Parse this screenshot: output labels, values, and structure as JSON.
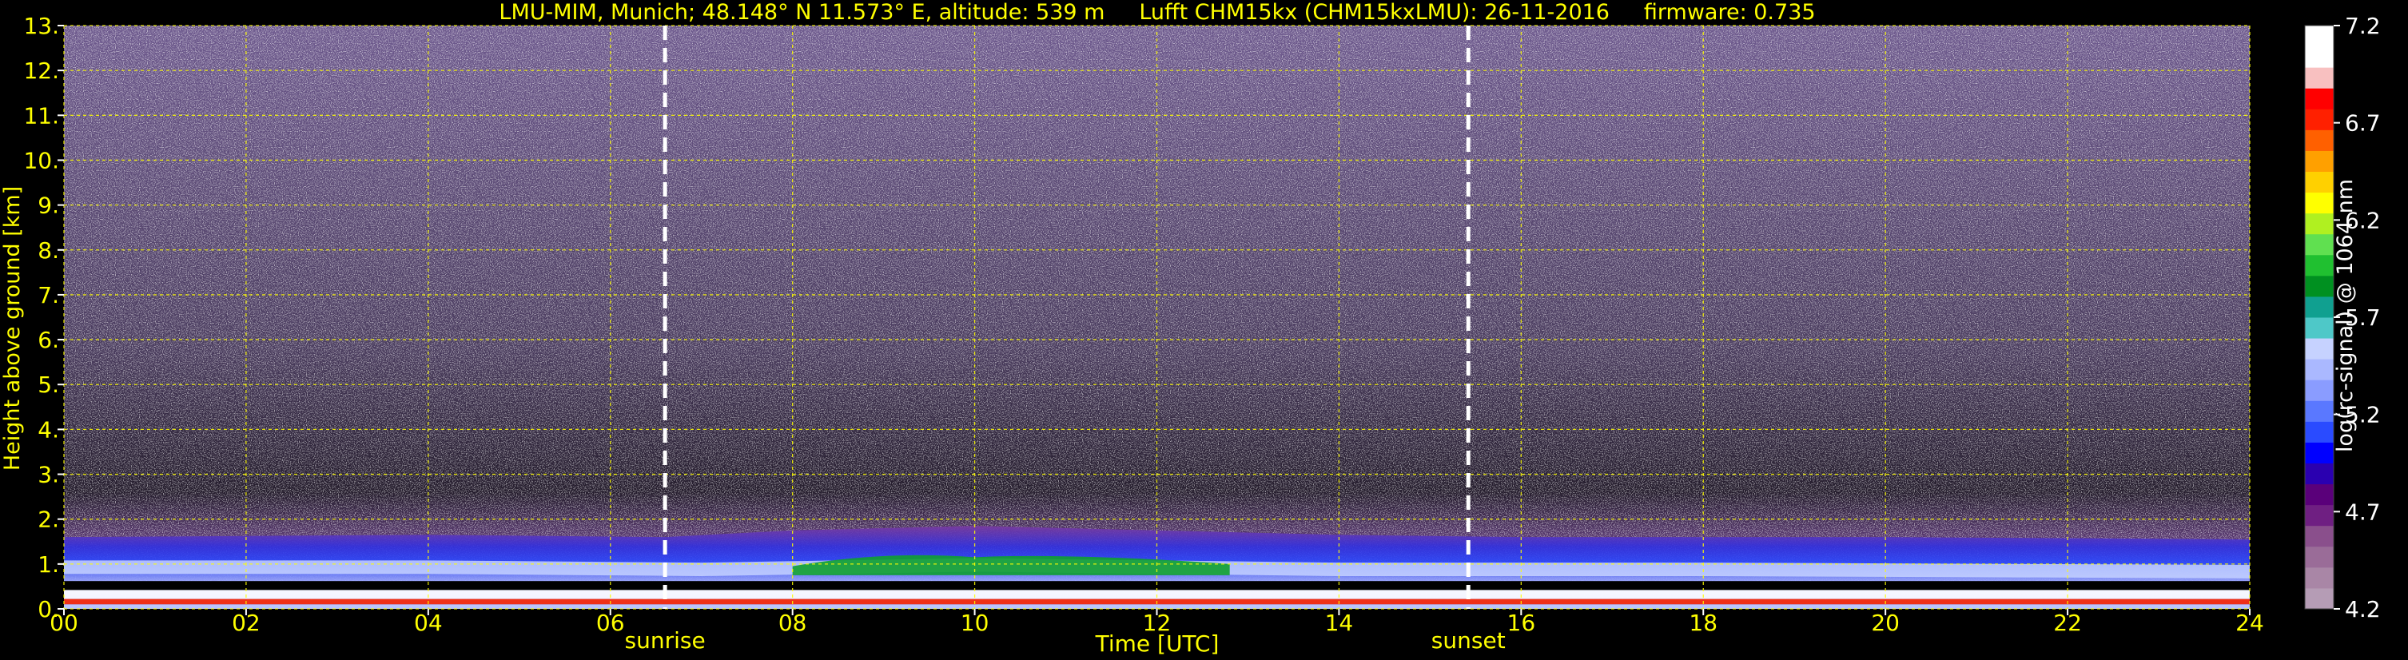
{
  "chart_data": {
    "type": "heatmap",
    "title": "LMU-MIM, Munich; 48.148° N 11.573° E, altitude: 539 m     Lufft CHM15kx (CHM15kxLMU): 26-11-2016     firmware: 0.735",
    "xlabel": "Time [UTC]",
    "ylabel": "Height above ground [km]",
    "xlim": [
      0,
      24
    ],
    "ylim": [
      0,
      13
    ],
    "x_ticks": [
      "00",
      "02",
      "04",
      "06",
      "08",
      "10",
      "12",
      "14",
      "16",
      "18",
      "20",
      "22",
      "24"
    ],
    "y_ticks": [
      "0.",
      "1.",
      "2.",
      "3.",
      "4.",
      "5.",
      "6.",
      "7.",
      "8.",
      "9.",
      "10.",
      "11.",
      "12.",
      "13."
    ],
    "grid": true,
    "grid_color": "#ffff00",
    "markers": [
      {
        "label": "sunrise",
        "time": 6.6
      },
      {
        "label": "sunset",
        "time": 15.42
      }
    ],
    "colorbar": {
      "label": "log(rc-signal) @ 1064 nm",
      "range": [
        4.2,
        7.2
      ],
      "ticks": [
        "4.2",
        "4.7",
        "5.2",
        "5.7",
        "6.2",
        "6.7",
        "7.2"
      ],
      "colors": [
        "#b59cb5",
        "#a986a6",
        "#9a6c98",
        "#8a4f8c",
        "#6f1f82",
        "#5a007a",
        "#2a00b0",
        "#0000ff",
        "#2a4bff",
        "#5a78ff",
        "#8a9cff",
        "#aab8ff",
        "#c6d2ff",
        "#4ec8c8",
        "#10a090",
        "#009020",
        "#20c030",
        "#60e050",
        "#b0f020",
        "#ffff00",
        "#ffd000",
        "#ffa000",
        "#ff6000",
        "#ff2000",
        "#ff0000",
        "#f8c0c0",
        "#ffffff",
        "#ffffff"
      ]
    },
    "boundary_layer_top_km": [
      {
        "time": 0,
        "value": 1.6
      },
      {
        "time": 4,
        "value": 1.65
      },
      {
        "time": 6.6,
        "value": 1.6
      },
      {
        "time": 8,
        "value": 1.75
      },
      {
        "time": 10,
        "value": 1.85
      },
      {
        "time": 12,
        "value": 1.75
      },
      {
        "time": 14,
        "value": 1.65
      },
      {
        "time": 16,
        "value": 1.6
      },
      {
        "time": 20,
        "value": 1.6
      },
      {
        "time": 24,
        "value": 1.55
      }
    ],
    "aerosol_layer_center_km": [
      {
        "time": 0,
        "value": 0.9
      },
      {
        "time": 4,
        "value": 0.9
      },
      {
        "time": 7,
        "value": 0.85
      },
      {
        "time": 10,
        "value": 0.95
      },
      {
        "time": 12,
        "value": 0.9
      },
      {
        "time": 14,
        "value": 0.85
      },
      {
        "time": 18,
        "value": 0.85
      },
      {
        "time": 24,
        "value": 0.8
      }
    ]
  }
}
